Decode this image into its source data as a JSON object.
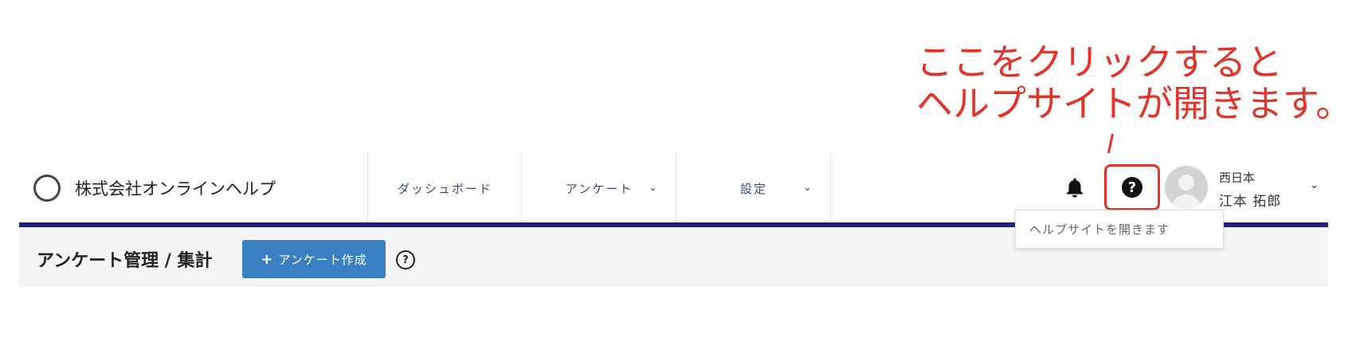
{
  "annotation": {
    "line1": "ここをクリックすると",
    "line2": "ヘルプサイトが開きます。",
    "color": "#e0352b"
  },
  "header": {
    "company_name": "株式会社オンラインヘルプ",
    "nav": [
      {
        "label": "ダッシュボード",
        "has_dropdown": false
      },
      {
        "label": "アンケート",
        "has_dropdown": true,
        "chevron": "⌄"
      },
      {
        "label": "設定",
        "has_dropdown": true,
        "chevron": "⌄"
      }
    ],
    "icons": {
      "bell": "bell-icon",
      "help": "question-circle-icon",
      "avatar": "user-avatar-icon"
    },
    "help_symbol": "?",
    "user": {
      "org": "西日本",
      "name": "江本 拓郎",
      "chevron": "⌄"
    }
  },
  "tooltip": {
    "text": "ヘルプサイトを開きます"
  },
  "subbar": {
    "title": "アンケート管理 / 集計",
    "create_button": {
      "icon": "+",
      "label": "アンケート作成"
    },
    "help_symbol": "?"
  },
  "colors": {
    "accent_rule": "#20237a",
    "primary_button": "#3a7fc1",
    "highlight": "#e0352b"
  }
}
